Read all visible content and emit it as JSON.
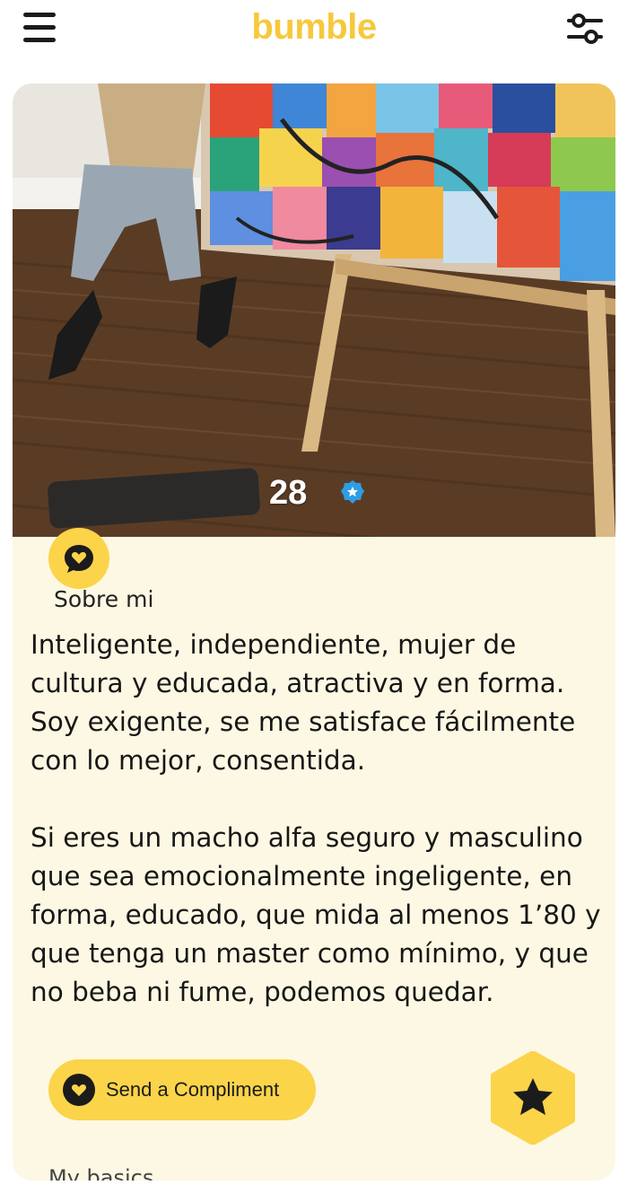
{
  "header": {
    "logo": "bumble",
    "menu_icon": "hamburger-menu-icon",
    "filter_icon": "filter-sliders-icon"
  },
  "profile": {
    "age": "28",
    "verified_icon": "verified-badge-icon",
    "about_label": "Sobre mi",
    "about_paragraphs": [
      "Inteligente, independiente, mujer de cultura y educada, atractiva y en forma. Soy exigente, se me satisface fácilmente con lo mejor, consentida.",
      "Si eres un macho alfa seguro y masculino que sea emocionalmente ingeligente, en forma, educado, que mida al menos 1’80 y que tenga un master como mínimo, y que no beba ni fume, podemos quedar."
    ],
    "compliment_button": "Send a Compliment",
    "next_section_partial": "My basics"
  },
  "colors": {
    "brand_yellow": "#fbd44a",
    "logo_yellow": "#f7c83b",
    "card_bg": "#fdf8e3",
    "verified_blue": "#2f9de4"
  }
}
